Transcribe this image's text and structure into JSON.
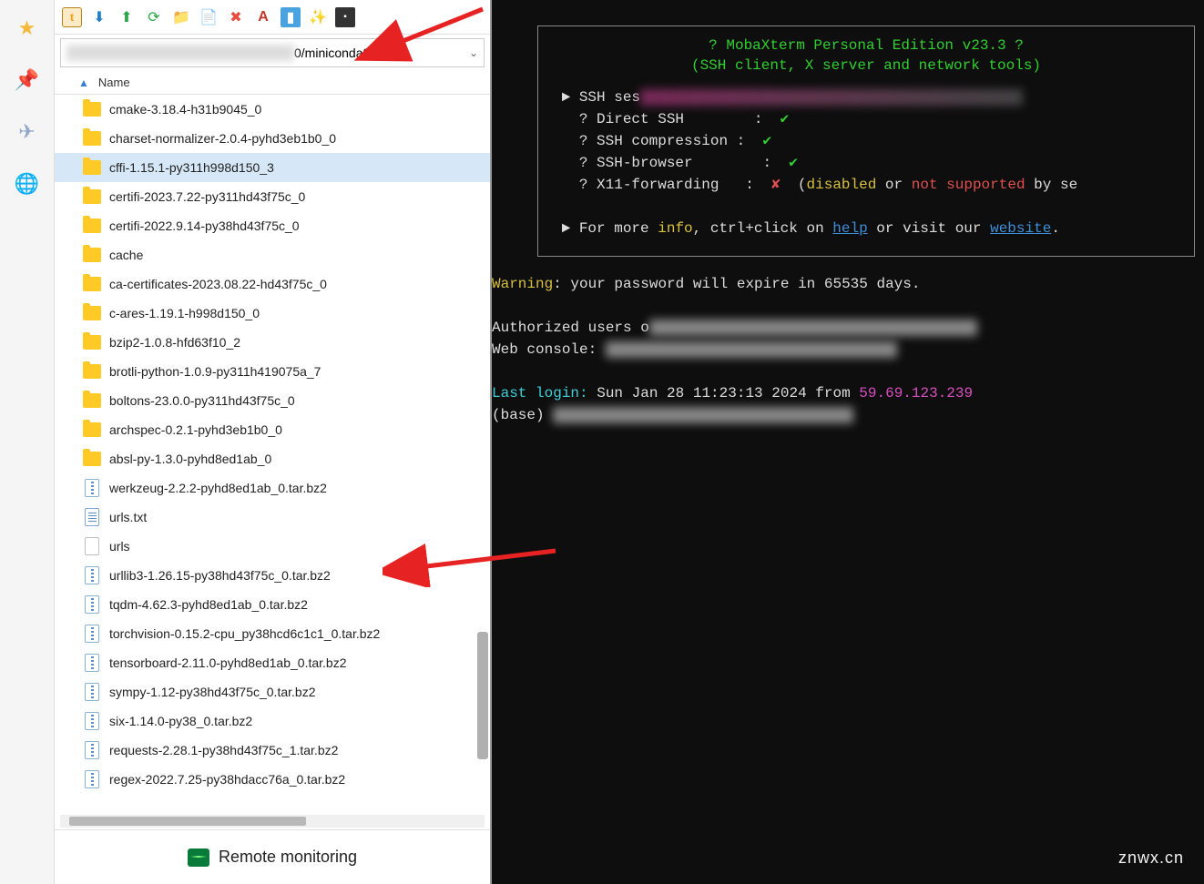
{
  "sidebar": {
    "icons": [
      "star-icon",
      "pin-icon",
      "send-icon",
      "globe-icon"
    ]
  },
  "toolbar": {
    "icons": [
      "home",
      "download",
      "upload",
      "refresh",
      "newfolder",
      "newfile",
      "delete",
      "font",
      "app",
      "wand",
      "terminal"
    ]
  },
  "path_visible": "0/miniconda3/pkgs/",
  "columns": {
    "name": "Name"
  },
  "files": [
    {
      "type": "folder",
      "name": "cmake-3.18.4-h31b9045_0"
    },
    {
      "type": "folder",
      "name": "charset-normalizer-2.0.4-pyhd3eb1b0_0"
    },
    {
      "type": "folder",
      "name": "cffi-1.15.1-py311h998d150_3",
      "selected": true
    },
    {
      "type": "folder",
      "name": "certifi-2023.7.22-py311hd43f75c_0"
    },
    {
      "type": "folder",
      "name": "certifi-2022.9.14-py38hd43f75c_0"
    },
    {
      "type": "folder",
      "name": "cache"
    },
    {
      "type": "folder",
      "name": "ca-certificates-2023.08.22-hd43f75c_0"
    },
    {
      "type": "folder",
      "name": "c-ares-1.19.1-h998d150_0"
    },
    {
      "type": "folder",
      "name": "bzip2-1.0.8-hfd63f10_2"
    },
    {
      "type": "folder",
      "name": "brotli-python-1.0.9-py311h419075a_7"
    },
    {
      "type": "folder",
      "name": "boltons-23.0.0-py311hd43f75c_0"
    },
    {
      "type": "folder",
      "name": "archspec-0.2.1-pyhd3eb1b0_0"
    },
    {
      "type": "folder",
      "name": "absl-py-1.3.0-pyhd8ed1ab_0"
    },
    {
      "type": "zip",
      "name": "werkzeug-2.2.2-pyhd8ed1ab_0.tar.bz2"
    },
    {
      "type": "txt",
      "name": "urls.txt"
    },
    {
      "type": "blank",
      "name": "urls"
    },
    {
      "type": "zip",
      "name": "urllib3-1.26.15-py38hd43f75c_0.tar.bz2"
    },
    {
      "type": "zip",
      "name": "tqdm-4.62.3-pyhd8ed1ab_0.tar.bz2"
    },
    {
      "type": "zip",
      "name": "torchvision-0.15.2-cpu_py38hcd6c1c1_0.tar.bz2"
    },
    {
      "type": "zip",
      "name": "tensorboard-2.11.0-pyhd8ed1ab_0.tar.bz2"
    },
    {
      "type": "zip",
      "name": "sympy-1.12-py38hd43f75c_0.tar.bz2"
    },
    {
      "type": "zip",
      "name": "six-1.14.0-py38_0.tar.bz2"
    },
    {
      "type": "zip",
      "name": "requests-2.28.1-py38hd43f75c_1.tar.bz2"
    },
    {
      "type": "zip",
      "name": "regex-2022.7.25-py38hdacc76a_0.tar.bz2"
    }
  ],
  "footer": {
    "label": "Remote monitoring"
  },
  "terminal": {
    "title": "? MobaXterm Personal Edition v23.3 ?",
    "subtitle": "(SSH client, X server and network tools)",
    "session_label": "SSH ses",
    "direct_ssh": "? Direct SSH        : ",
    "compression": "? SSH compression : ",
    "browser": "? SSH-browser        : ",
    "x11": "? X11-forwarding   : ",
    "x11_tail_1": "  (",
    "x11_disabled": "disabled",
    "x11_or": " or ",
    "x11_not_supported": "not supported",
    "x11_by": " by se",
    "more_info_pre": "► For more ",
    "info": "info",
    "more_info_mid": ", ctrl+click on ",
    "help": "help",
    "more_info_or": " or visit our ",
    "website": "website",
    "more_info_end": ".",
    "warning_label": "Warning",
    "warning_text": ": your password will expire in 65535 days.",
    "auth_text": "Authorized users o",
    "web_console": "Web console: ",
    "last_login_label": "Last login:",
    "last_login_text": " Sun Jan 28 11:23:13 2024 from ",
    "last_login_ip": "59.69.123.239",
    "prompt": "(base)"
  },
  "watermark": "znwx.cn"
}
